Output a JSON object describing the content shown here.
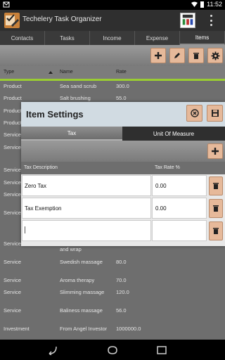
{
  "status": {
    "time": "11:52"
  },
  "app": {
    "title": "Techelery Task Organizer"
  },
  "tabs": [
    {
      "label": "Contacts"
    },
    {
      "label": "Tasks"
    },
    {
      "label": "Income"
    },
    {
      "label": "Expense"
    },
    {
      "label": "Items",
      "active": true
    }
  ],
  "table": {
    "headers": {
      "type": "Type",
      "name": "Name",
      "rate": "Rate"
    },
    "rows": [
      {
        "type": "Product",
        "name": "Sea sand scrub",
        "rate": "300.0"
      },
      {
        "type": "Product",
        "name": "Salt brushing",
        "rate": "55.0"
      },
      {
        "type": "Product",
        "name": "",
        "rate": ""
      },
      {
        "type": "Product",
        "name": "",
        "rate": ""
      },
      {
        "type": "Service",
        "name": "",
        "rate": ""
      },
      {
        "type": "Service",
        "name": "",
        "rate": ""
      },
      {
        "type": "Service",
        "name": "",
        "rate": ""
      },
      {
        "type": "Service",
        "name": "",
        "rate": ""
      },
      {
        "type": "Service",
        "name": "",
        "rate": ""
      },
      {
        "type": "Service",
        "name": "",
        "rate": ""
      },
      {
        "type": "Service",
        "name": "",
        "rate": ""
      },
      {
        "type": "Service",
        "name": "and wrap",
        "rate": ""
      },
      {
        "type": "Service",
        "name": "Swedish massage",
        "rate": "80.0"
      },
      {
        "type": "Service",
        "name": "Aroma therapy",
        "rate": "70.0"
      },
      {
        "type": "Service",
        "name": "Slimming massage",
        "rate": "120.0"
      },
      {
        "type": "Service",
        "name": "Baliness massage",
        "rate": "56.0"
      },
      {
        "type": "Investment",
        "name": "From Angel Investor",
        "rate": "1000000.0"
      }
    ]
  },
  "dialog": {
    "title": "Item Settings",
    "tabs": {
      "tax": "Tax",
      "uom": "Unit Of Measure"
    },
    "headers": {
      "desc": "Tax Description",
      "rate": "Tax Rate %"
    },
    "rows": [
      {
        "desc": "Zero Tax",
        "rate": "0.00"
      },
      {
        "desc": "Tax Exemption",
        "rate": "0.00"
      },
      {
        "desc": "",
        "rate": ""
      }
    ]
  },
  "colors": {
    "accent_button": "#e6b99a",
    "selection_line": "#9acd32",
    "dialog_header": "#d1dbe2"
  }
}
